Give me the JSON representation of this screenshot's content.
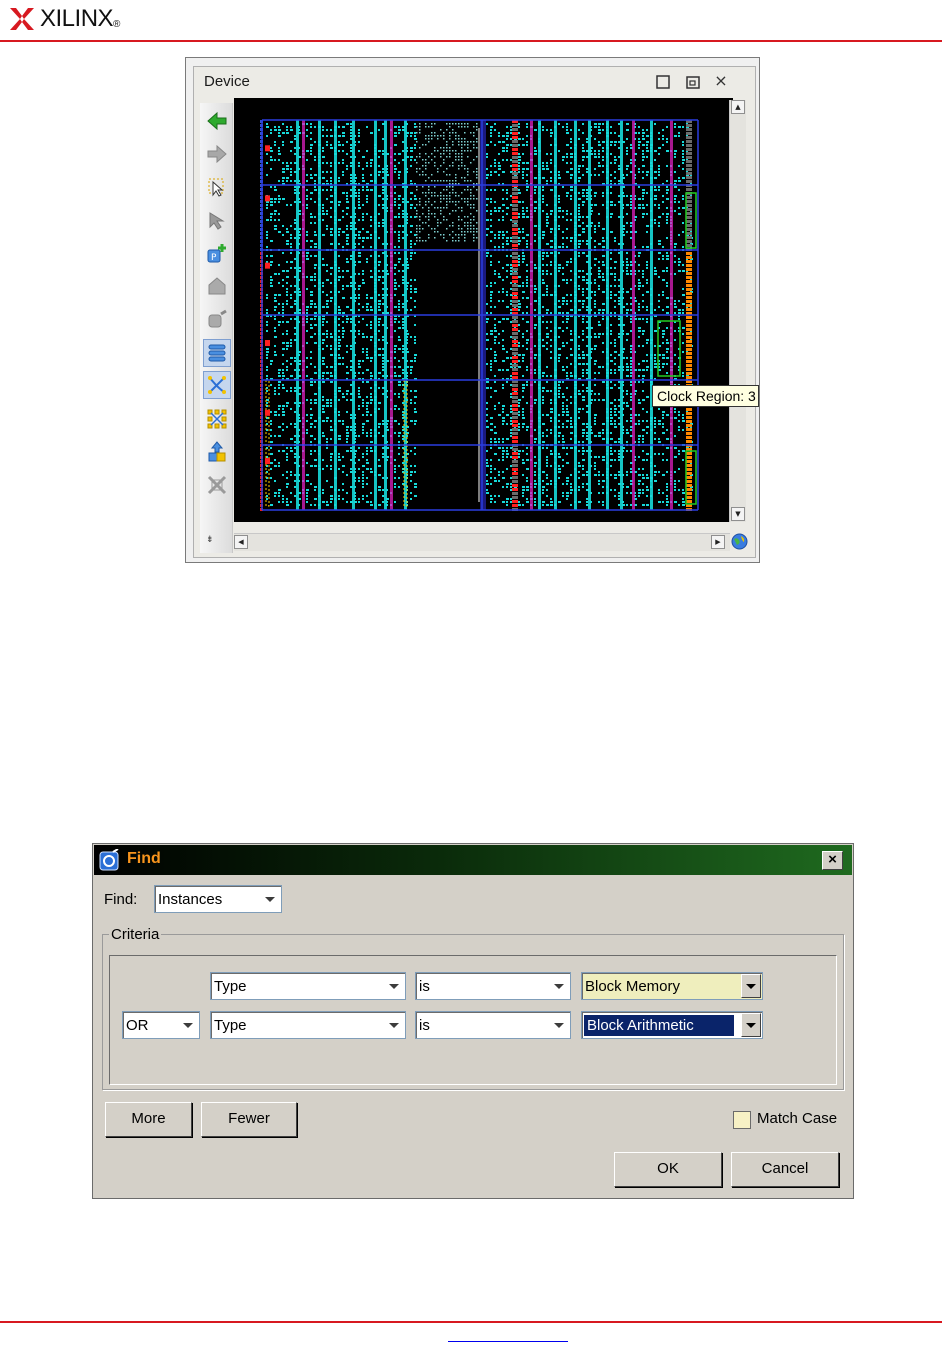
{
  "branding": {
    "logo_text": "XILINX",
    "registered_mark": "®",
    "accent_color": "#d71920"
  },
  "device_window": {
    "title": "Device",
    "window_buttons": [
      "maximize-icon",
      "restore-icon",
      "close-icon"
    ],
    "close_glyph": "×",
    "toolbar_tools": [
      "back-arrow-icon",
      "forward-arrow-icon",
      "select-arrow-icon",
      "route-icon",
      "add-pblock-icon",
      "place-icon",
      "io-icon",
      "layers-icon",
      "net-routing-icon",
      "cell-array-icon",
      "move-icon",
      "unroute-icon"
    ],
    "active_tools": [
      "layers-icon",
      "net-routing-icon"
    ],
    "tooltip": "Clock Region: 3",
    "colors": {
      "canvas_bg": "#000000",
      "logic": "#17d9d9",
      "clock_region_lines": "#2a3de0",
      "ram": "#e020c0",
      "io": "#ff2020",
      "io_bank": "#ffcc00",
      "pblock": "#22cc22"
    }
  },
  "find_dialog": {
    "title": "Find",
    "title_color": "#f7941d",
    "close_glyph": "×",
    "find_label": "Find:",
    "find_value": "Instances",
    "criteria_label": "Criteria",
    "rows": [
      {
        "logic": "",
        "property": "Type",
        "operator": "is",
        "value": "Block Memory"
      },
      {
        "logic": "OR",
        "property": "Type",
        "operator": "is",
        "value": "Block Arithmetic"
      }
    ],
    "more_button": "More",
    "fewer_button": "Fewer",
    "match_case_label": "Match Case",
    "match_case_checked": false,
    "ok_button": "OK",
    "cancel_button": "Cancel"
  }
}
